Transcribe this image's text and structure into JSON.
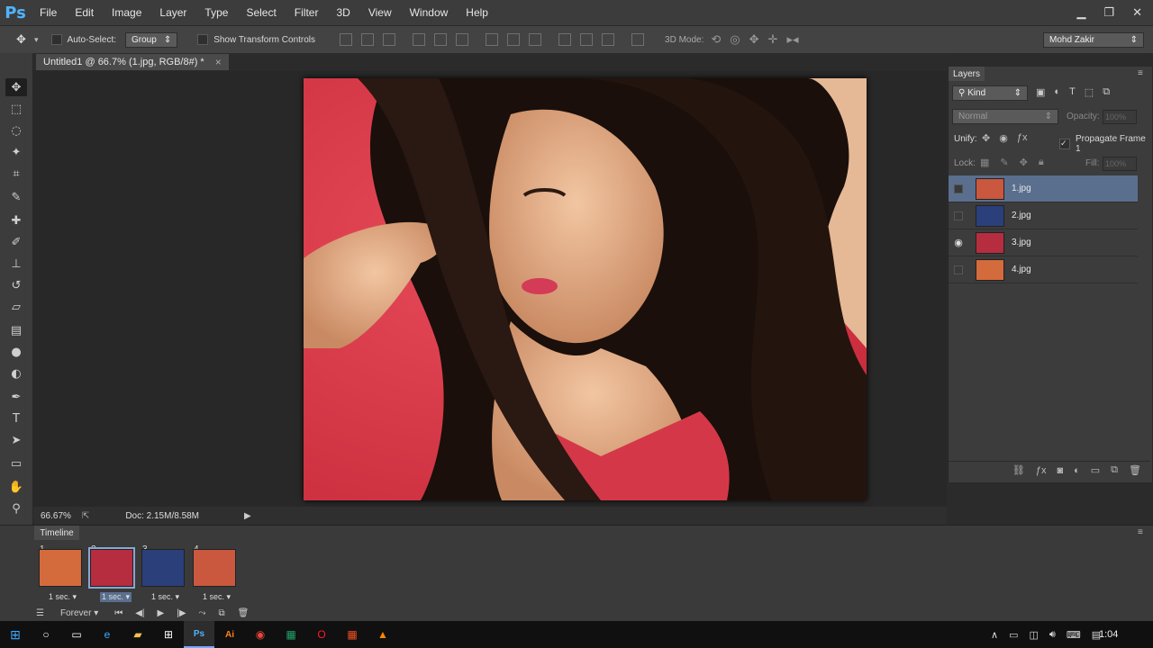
{
  "app": {
    "logo": "Ps"
  },
  "menu": [
    "File",
    "Edit",
    "Image",
    "Layer",
    "Type",
    "Select",
    "Filter",
    "3D",
    "View",
    "Window",
    "Help"
  ],
  "window_controls": {
    "minimize": "▁",
    "restore": "❐",
    "close": "✕"
  },
  "options": {
    "auto_select_label": "Auto-Select:",
    "group_value": "Group",
    "transform_controls_label": "Show Transform Controls",
    "three_d_mode_label": "3D Mode:",
    "workspace": "Mohd Zakir"
  },
  "document": {
    "tab_title": "Untitled1 @ 66.7% (1.jpg, RGB/8#) *",
    "close": "×"
  },
  "status": {
    "zoom": "66.67%",
    "doc": "Doc: 2.15M/8.58M"
  },
  "layers_panel": {
    "title": "Layers",
    "filter_kind": "Kind",
    "blend_mode": "Normal",
    "opacity_label": "Opacity:",
    "opacity_value": "100%",
    "unify_label": "Unify:",
    "propagate_label": "Propagate Frame 1",
    "lock_label": "Lock:",
    "fill_label": "Fill:",
    "fill_value": "100%",
    "layers": [
      {
        "name": "1.jpg",
        "visible": false,
        "selected": true,
        "thumb_color": "#c9583f"
      },
      {
        "name": "2.jpg",
        "visible": false,
        "selected": false,
        "thumb_color": "#2b3f7a"
      },
      {
        "name": "3.jpg",
        "visible": true,
        "selected": false,
        "thumb_color": "#b52d3f"
      },
      {
        "name": "4.jpg",
        "visible": false,
        "selected": false,
        "thumb_color": "#d46b3d"
      }
    ]
  },
  "timeline": {
    "title": "Timeline",
    "loop": "Forever",
    "frames": [
      {
        "num": "1",
        "delay": "1 sec.",
        "thumb_color": "#d46b3d"
      },
      {
        "num": "2",
        "delay": "1 sec.",
        "thumb_color": "#b52d3f"
      },
      {
        "num": "3",
        "delay": "1 sec.",
        "thumb_color": "#2b3f7a"
      },
      {
        "num": "4",
        "delay": "1 sec.",
        "thumb_color": "#c9583f"
      }
    ]
  },
  "taskbar": {
    "time": "1:04"
  }
}
